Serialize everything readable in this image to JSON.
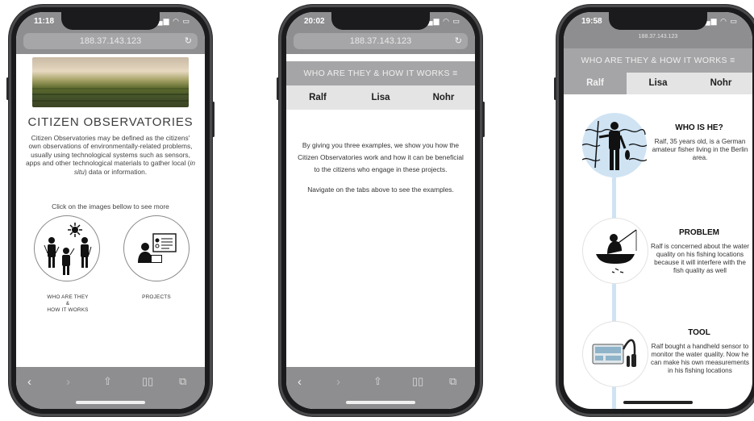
{
  "phone1": {
    "status_time": "11:18",
    "url": "188.37.143.123",
    "title": "CITIZEN OBSERVATORIES",
    "description_before": "Citizen Observatories may be defined as the citizens' own observations of environmentally-related problems, usually using technological systems such as sensors, apps and other technological materials to gather local (",
    "description_italic": "in situ",
    "description_after": ") data or information.",
    "click_prompt": "Click on the images bellow to see more",
    "card1_line1": "WHO ARE THEY",
    "card1_line2": "&",
    "card1_line3": "HOW IT WORKS",
    "card2_label": "PROJECTS"
  },
  "phone2": {
    "status_time": "20:02",
    "url": "188.37.143.123",
    "menu_title": "WHO ARE THEY & HOW IT WORKS",
    "tabs": [
      "Ralf",
      "Lisa",
      "Nohr"
    ],
    "intro": "By giving you three examples, we show you how the Citizen Observatories work and how it can be beneficial to the citizens who engage in these projects.",
    "navigate": "Navigate on the tabs above to see the examples."
  },
  "phone3": {
    "status_time": "19:58",
    "url": "188.37.143.123",
    "menu_title": "WHO ARE THEY & HOW IT WORKS",
    "tabs": [
      "Ralf",
      "Lisa",
      "Nohr"
    ],
    "active_tab": "Ralf",
    "sections": [
      {
        "heading": "WHO IS HE?",
        "text": "Ralf, 35 years old, is a German amateur fisher living in the Berlin area."
      },
      {
        "heading": "PROBLEM",
        "text": "Ralf is concerned about the water quality on his fishing locations because it will interfere with the fish quality as well"
      },
      {
        "heading": "TOOL",
        "text": "Ralf bought a handheld sensor to monitor the water quality. Now he can make his own measurements in his fishing locations"
      }
    ]
  },
  "colors": {
    "chrome_gray": "#8e8e90",
    "menu_gray": "#a5a5a7",
    "tab_bg": "#e4e4e5",
    "accent_blue": "#cfe3f3"
  },
  "icons": [
    "signal-icon",
    "wifi-icon",
    "battery-icon",
    "reload-icon",
    "back-icon",
    "forward-icon",
    "share-icon",
    "bookmarks-icon",
    "tabs-icon",
    "hamburger-icon",
    "sun-icon"
  ]
}
